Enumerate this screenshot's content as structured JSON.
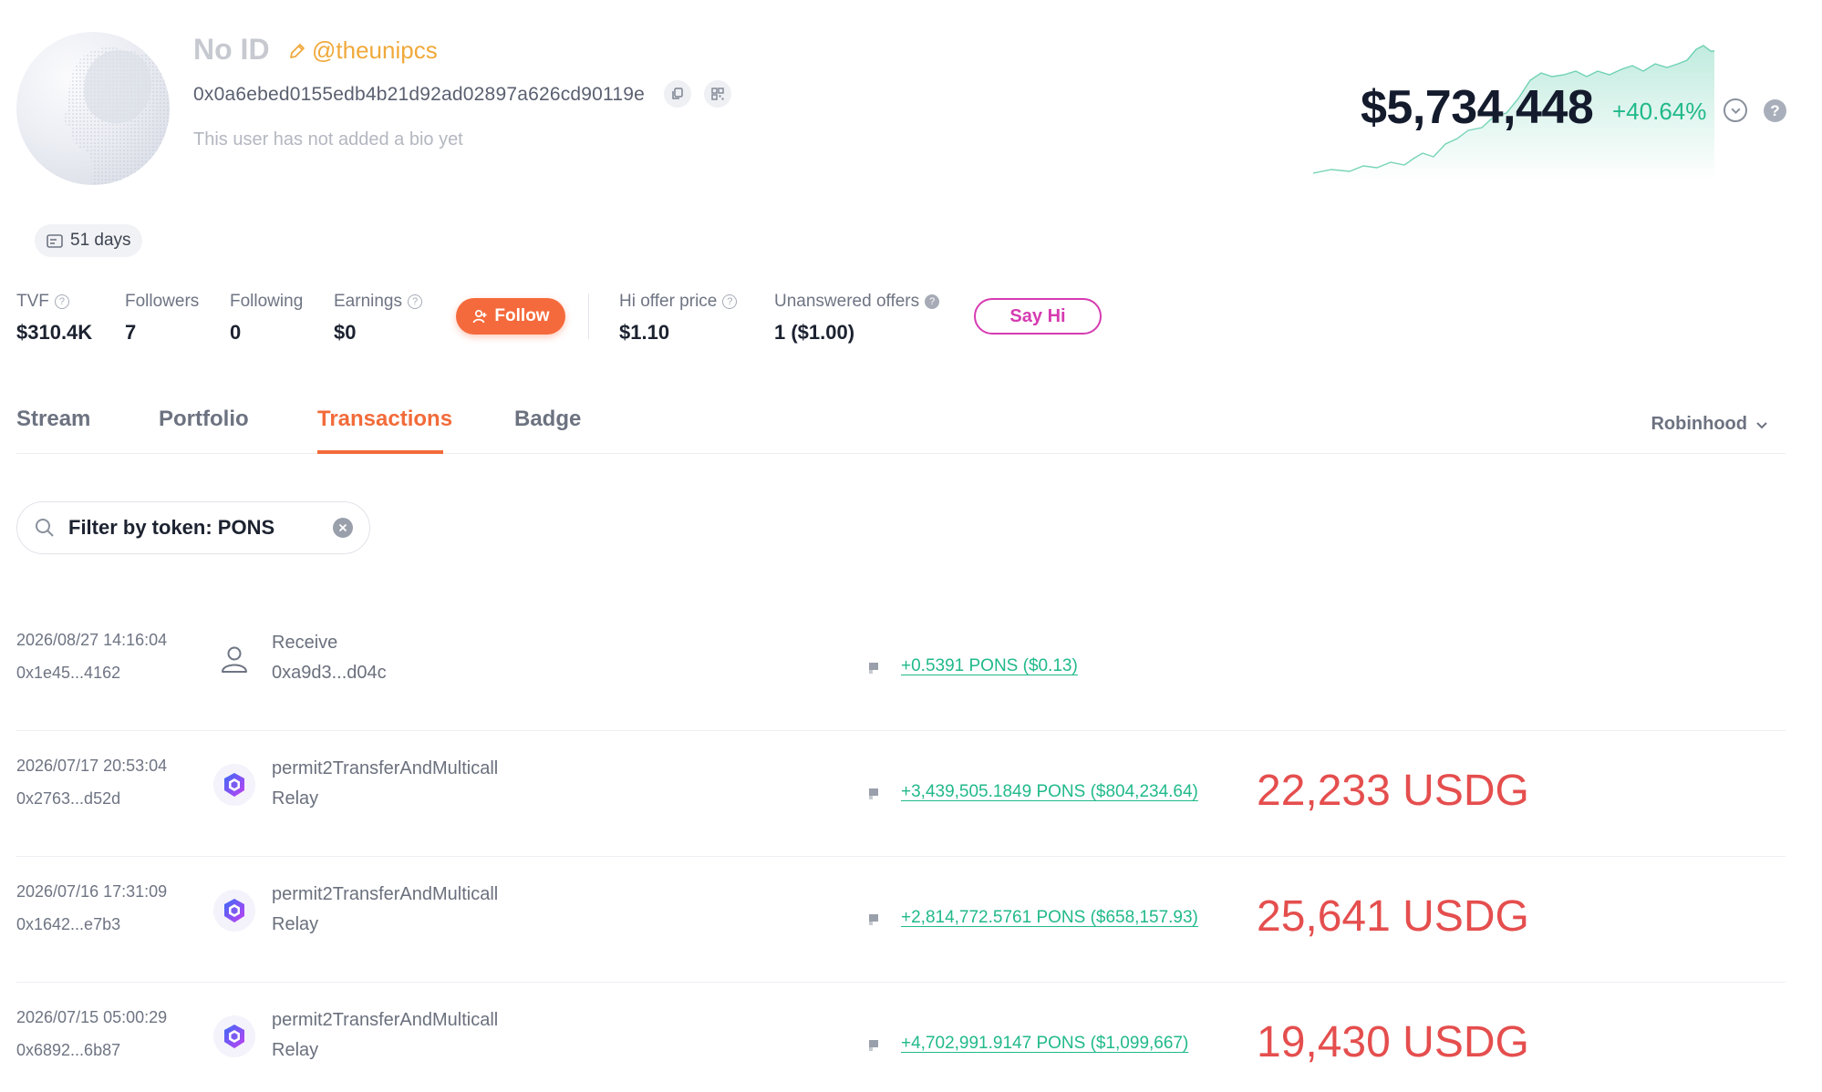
{
  "profile": {
    "display_name": "No ID",
    "handle": "@theunipcs",
    "address": "0x0a6ebed0155edb4b21d92ad02897a626cd90119e",
    "bio": "This user has not added a bio yet",
    "days_badge": "51 days"
  },
  "portfolio_value": {
    "amount": "$5,734,448",
    "change": "+40.64%",
    "help": "?",
    "accent_color": "#21b98a"
  },
  "stats": {
    "tvf": {
      "label": "TVF",
      "value": "$310.4K"
    },
    "followers": {
      "label": "Followers",
      "value": "7"
    },
    "following": {
      "label": "Following",
      "value": "0"
    },
    "earnings": {
      "label": "Earnings",
      "value": "$0"
    },
    "follow_label": "Follow",
    "hi_offer": {
      "label": "Hi offer price",
      "value": "$1.10"
    },
    "unanswered": {
      "label": "Unanswered offers",
      "value": "1 ($1.00)"
    },
    "say_hi_label": "Say Hi"
  },
  "tabs": [
    {
      "label": "Stream"
    },
    {
      "label": "Portfolio"
    },
    {
      "label": "Transactions",
      "active": true
    },
    {
      "label": "Badge"
    }
  ],
  "network": "Robinhood",
  "filter": {
    "value": "Filter by token: PONS"
  },
  "transactions": [
    {
      "date": "2026/08/27 14:16:04",
      "hash": "0x1e45...4162",
      "method": "Receive",
      "sub": "0xa9d3...d04c",
      "icon": "user-icon",
      "amount": "+0.5391 PONS ($0.13)",
      "big": ""
    },
    {
      "date": "2026/07/17 20:53:04",
      "hash": "0x2763...d52d",
      "method": "permit2TransferAndMulticall",
      "sub": "Relay",
      "icon": "relay-icon",
      "amount": "+3,439,505.1849 PONS ($804,234.64)",
      "big": "22,233 USDG"
    },
    {
      "date": "2026/07/16 17:31:09",
      "hash": "0x1642...e7b3",
      "method": "permit2TransferAndMulticall",
      "sub": "Relay",
      "icon": "relay-icon",
      "amount": "+2,814,772.5761 PONS ($658,157.93)",
      "big": "25,641 USDG"
    },
    {
      "date": "2026/07/15 05:00:29",
      "hash": "0x6892...6b87",
      "method": "permit2TransferAndMulticall",
      "sub": "Relay",
      "icon": "relay-icon",
      "amount": "+4,702,991.9147 PONS ($1,099,667)",
      "big": "19,430 USDG"
    }
  ],
  "colors": {
    "brand_orange": "#f26b3a",
    "follow_bg": "#f56a3c",
    "say_hi": "#d63bb1",
    "positive": "#21b98a",
    "annotation_red": "#e54e4e",
    "handle": "#f0a93b"
  }
}
